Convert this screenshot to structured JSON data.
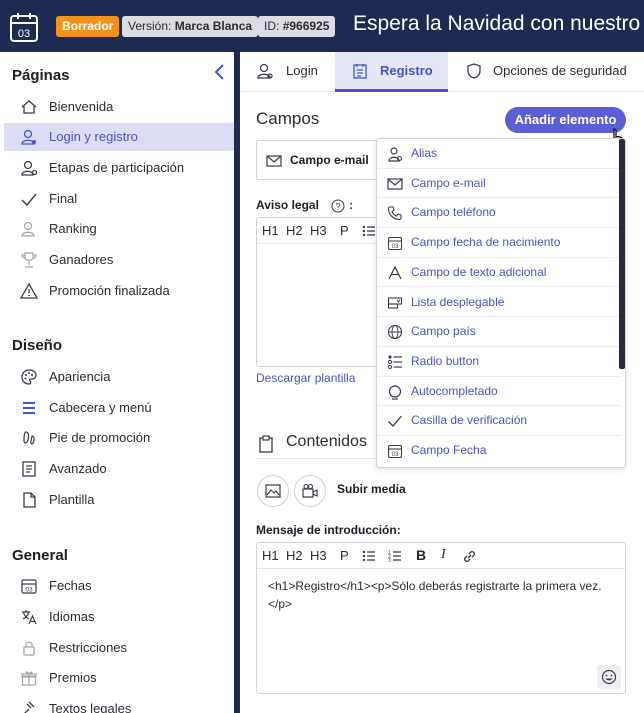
{
  "topbar": {
    "calendar_day": "03",
    "status_badge": "Borrador",
    "version_prefix": "Versión:",
    "version_value": "Marca Blanca",
    "id_prefix": "ID:",
    "id_value": "#966925",
    "title": "Espera la Navidad con nuestro"
  },
  "sidebar": {
    "section_pages": "Páginas",
    "section_design": "Diseño",
    "section_general": "General",
    "pages": [
      {
        "label": "Bienvenida",
        "icon": "home-icon"
      },
      {
        "label": "Login y registro",
        "icon": "user-key-icon",
        "active": true
      },
      {
        "label": "Etapas de participación",
        "icon": "user-gear-icon"
      },
      {
        "label": "Final",
        "icon": "check-icon"
      },
      {
        "label": "Ranking",
        "icon": "user-rank-icon"
      },
      {
        "label": "Ganadores",
        "icon": "trophy-icon"
      },
      {
        "label": "Promoción finalizada",
        "icon": "warning-icon"
      }
    ],
    "design": [
      {
        "label": "Apariencia",
        "icon": "palette-icon"
      },
      {
        "label": "Cabecera y menú",
        "icon": "menu-icon"
      },
      {
        "label": "Pie de promoción",
        "icon": "footprint-icon"
      },
      {
        "label": "Avanzado",
        "icon": "advanced-icon"
      },
      {
        "label": "Plantilla",
        "icon": "file-icon"
      }
    ],
    "general": [
      {
        "label": "Fechas",
        "icon": "calendar-icon"
      },
      {
        "label": "Idiomas",
        "icon": "translate-icon"
      },
      {
        "label": "Restricciones",
        "icon": "lock-icon"
      },
      {
        "label": "Premios",
        "icon": "gift-icon"
      },
      {
        "label": "Textos legales",
        "icon": "gavel-icon"
      }
    ]
  },
  "tabs": [
    {
      "label": "Login",
      "icon": "user-key-icon"
    },
    {
      "label": "Registro",
      "icon": "form-icon",
      "active": true
    },
    {
      "label": "Opciones de seguridad",
      "icon": "shield-icon"
    }
  ],
  "campos": {
    "title": "Campos",
    "add_button": "Añadir elemento",
    "field_email": "Campo e-mail"
  },
  "aviso": {
    "label": "Aviso legal",
    "colon": ":",
    "download": "Descargar plantilla"
  },
  "editor_toolbar": [
    "H1",
    "H2",
    "H3",
    "P"
  ],
  "contenidos": {
    "title": "Contenidos",
    "upload_label": "Subir media",
    "intro_label": "Mensaje de introducción:",
    "intro_text": "<h1>Registro</h1><p>Sólo deberás registrarte la primera vez.</p>"
  },
  "dropdown": [
    {
      "label": "Alias",
      "icon": "user-alias-icon"
    },
    {
      "label": "Campo e-mail",
      "icon": "mail-icon"
    },
    {
      "label": "Campo teléfono",
      "icon": "phone-icon"
    },
    {
      "label": "Campo fecha de nacimiento",
      "icon": "calendar-icon"
    },
    {
      "label": "Campo de texto adicional",
      "icon": "text-a-icon"
    },
    {
      "label": "Lista desplegable",
      "icon": "dropdown-list-icon"
    },
    {
      "label": "Campo país",
      "icon": "globe-icon"
    },
    {
      "label": "Radio button",
      "icon": "radio-list-icon"
    },
    {
      "label": "Autocompletado",
      "icon": "autocomplete-icon"
    },
    {
      "label": "Casilla de verificación",
      "icon": "checkbox-check-icon"
    },
    {
      "label": "Campo Fecha",
      "icon": "calendar-icon"
    }
  ],
  "colors": {
    "navy": "#1f2a52",
    "accent": "#4b51c9",
    "button": "#5a5fd6",
    "draft_orange": "#f2911b"
  }
}
